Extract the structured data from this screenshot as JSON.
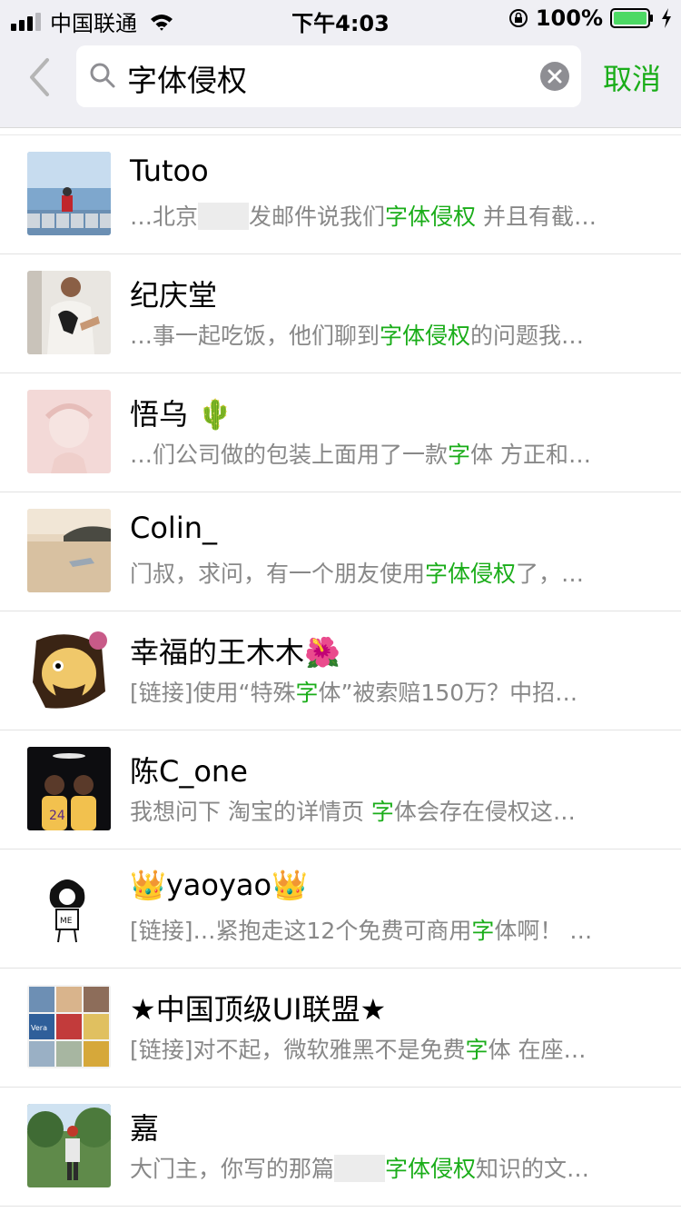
{
  "status_bar": {
    "carrier": "中国联通",
    "time": "下午4:03",
    "battery": "100%"
  },
  "search": {
    "query": "字体侵权",
    "cancel_label": "取消"
  },
  "accent_color": "#1aad19",
  "results": [
    {
      "name": "Tutoo",
      "snippet": {
        "a": "…北京",
        "b": "发邮件说我们",
        "hl": "字体侵权",
        "c": " 并且有截…"
      }
    },
    {
      "name": "纪庆堂",
      "snippet": {
        "a": "…事一起吃饭，他们聊到",
        "hl": "字体侵权",
        "c": "的问题我…"
      }
    },
    {
      "name": "悟乌 🌵",
      "snippet": {
        "a": "…们公司做的包装上面用了一款",
        "hl": "字",
        "c": "体 方正和…"
      }
    },
    {
      "name": "Colin_",
      "snippet": {
        "a": "门叔，求问，有一个朋友使用",
        "hl": "字体侵权",
        "c": "了，…"
      }
    },
    {
      "name": "幸福的王木木🌺",
      "snippet": {
        "a": "[链接]使用“特殊",
        "hl": "字",
        "c": "体”被索赔150万？中招…"
      }
    },
    {
      "name": "陈C_one",
      "snippet": {
        "a": "我想问下 淘宝的详情页 ",
        "hl": "字",
        "c": "体会存在侵权这…"
      }
    },
    {
      "name": "👑yaoyao👑",
      "snippet": {
        "a": "[链接]…紧抱走这12个免费可商用",
        "hl": "字",
        "c": "体啊！ …"
      }
    },
    {
      "name": "★中国顶级UI联盟★",
      "snippet": {
        "a": "[链接]对不起，微软雅黑不是免费",
        "hl": "字",
        "c": "体 在座…"
      }
    },
    {
      "name": "嘉",
      "snippet": {
        "a": "大门主，你写的那篇",
        "b": "",
        "hl": "字体侵权",
        "c": "知识的文…"
      }
    }
  ],
  "avatar_texts": {
    "kobe_jersey": "24",
    "ME": "ME",
    "vera": "Vera"
  }
}
